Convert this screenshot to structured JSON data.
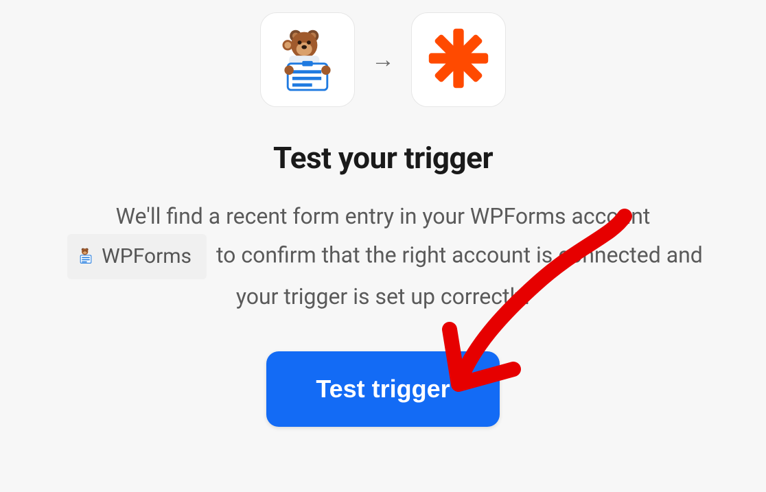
{
  "apps": {
    "source_name": "WPForms",
    "target_name": "Zapier"
  },
  "title": "Test your trigger",
  "description": {
    "part1": "We'll find a recent form entry in your WPForms account",
    "chip_label": "WPForms",
    "part2": "to confirm that the right account is connected and your trigger is set up correctly."
  },
  "button_label": "Test trigger"
}
